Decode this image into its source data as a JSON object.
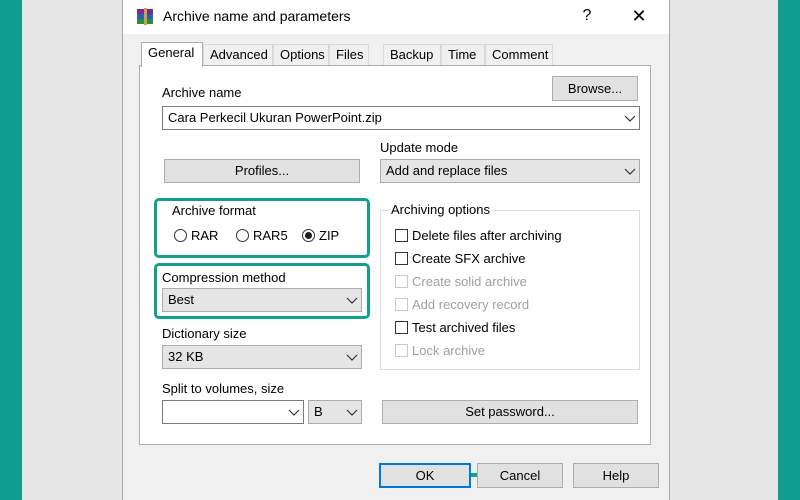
{
  "window": {
    "title": "Archive name and parameters",
    "help_glyph": "?",
    "close_glyph": "✕"
  },
  "tabs": [
    {
      "label": "General",
      "active": true
    },
    {
      "label": "Advanced"
    },
    {
      "label": "Options"
    },
    {
      "label": "Files"
    },
    {
      "label": "Backup"
    },
    {
      "label": "Time"
    },
    {
      "label": "Comment"
    }
  ],
  "archive_name": {
    "label": "Archive name",
    "value": "Cara Perkecil Ukuran PowerPoint.zip",
    "browse_label": "Browse..."
  },
  "profiles_label": "Profiles...",
  "update_mode": {
    "label": "Update mode",
    "value": "Add and replace files"
  },
  "archive_format": {
    "label": "Archive format",
    "options": [
      {
        "label": "RAR",
        "selected": false
      },
      {
        "label": "RAR5",
        "selected": false
      },
      {
        "label": "ZIP",
        "selected": true
      }
    ]
  },
  "compression_method": {
    "label": "Compression method",
    "value": "Best"
  },
  "dictionary_size": {
    "label": "Dictionary size",
    "value": "32 KB"
  },
  "split_volumes": {
    "label": "Split to volumes, size",
    "value": "",
    "unit": "B"
  },
  "archiving_options": {
    "label": "Archiving options",
    "items": [
      {
        "label": "Delete files after archiving",
        "enabled": true,
        "checked": false
      },
      {
        "label": "Create SFX archive",
        "enabled": true,
        "checked": false
      },
      {
        "label": "Create solid archive",
        "enabled": false,
        "checked": false
      },
      {
        "label": "Add recovery record",
        "enabled": false,
        "checked": false
      },
      {
        "label": "Test archived files",
        "enabled": true,
        "checked": false
      },
      {
        "label": "Lock archive",
        "enabled": false,
        "checked": false
      }
    ]
  },
  "set_password_label": "Set password...",
  "footer": {
    "ok_label": "OK",
    "cancel_label": "Cancel",
    "help_label": "Help"
  },
  "colors": {
    "accent_teal": "#0e9d8e",
    "highlight_teal": "#12a08c",
    "focus_blue": "#0078d7"
  },
  "icons": {
    "app": "winrar-books-icon",
    "arrow": "teal-right-arrow-icon"
  }
}
